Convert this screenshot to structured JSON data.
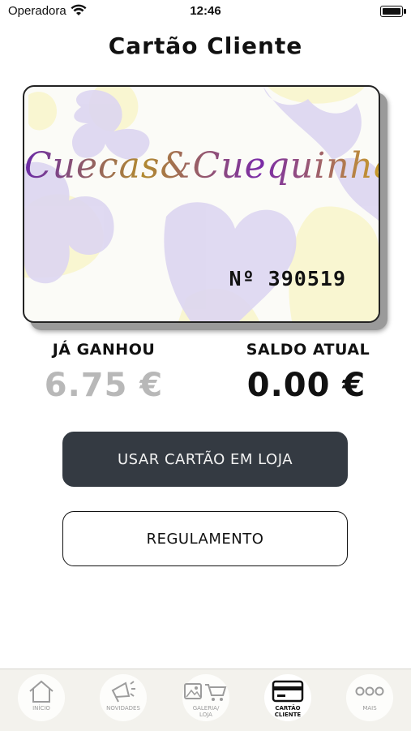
{
  "status_bar": {
    "carrier": "Operadora",
    "time": "12:46"
  },
  "header": {
    "title": "Cartão Cliente"
  },
  "card": {
    "brand": "Cuecas&Cuequinhas",
    "number": "Nº 390519"
  },
  "stats": {
    "earned_label": "JÁ GANHOU",
    "earned_value": "6.75 €",
    "balance_label": "SALDO ATUAL",
    "balance_value": "0.00 €"
  },
  "buttons": {
    "use_card": "USAR CARTÃO EM LOJA",
    "rules": "REGULAMENTO"
  },
  "tabbar": {
    "items": [
      {
        "label": "INÍCIO",
        "icon": "home-icon"
      },
      {
        "label": "NOVIDADES",
        "icon": "megaphone-icon"
      },
      {
        "label": "GALERIA/\nLOJA",
        "icon": "gallery-cart-icon"
      },
      {
        "label": "CARTÃO\nCLIENTE",
        "icon": "card-icon",
        "active": true
      },
      {
        "label": "MAIS",
        "icon": "more-icon"
      }
    ]
  },
  "colors": {
    "primary_button": "#343a42",
    "muted_value": "#b8b8b8",
    "card_purple": "#d9d2ef",
    "card_yellow": "#fbf8d6"
  }
}
